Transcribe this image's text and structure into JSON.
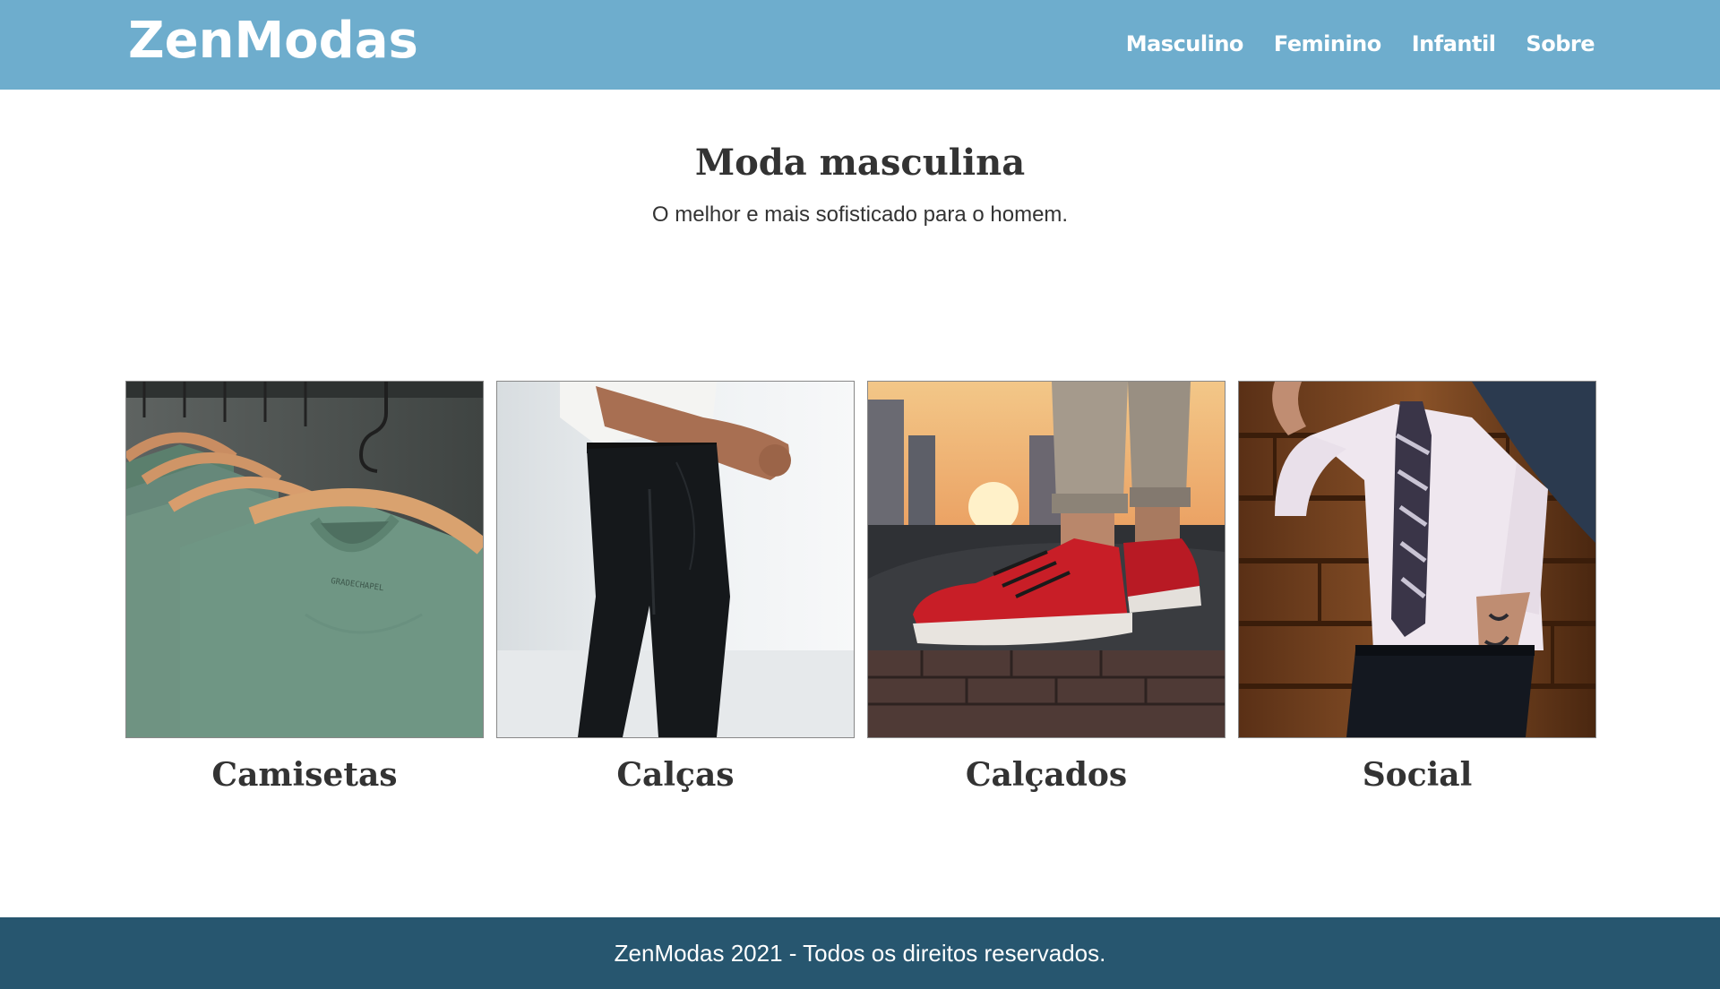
{
  "header": {
    "logo": "ZenModas",
    "nav": [
      {
        "label": "Masculino"
      },
      {
        "label": "Feminino"
      },
      {
        "label": "Infantil"
      },
      {
        "label": "Sobre"
      }
    ]
  },
  "hero": {
    "title": "Moda masculina",
    "subtitle": "O melhor e mais sofisticado para o homem."
  },
  "categories": [
    {
      "label": "Camisetas",
      "image": "green-tshirts-on-hangers"
    },
    {
      "label": "Calças",
      "image": "black-trousers"
    },
    {
      "label": "Calçados",
      "image": "red-sneakers"
    },
    {
      "label": "Social",
      "image": "shirt-and-tie"
    }
  ],
  "footer": {
    "text": "ZenModas 2021 - Todos os direitos reservados."
  },
  "colors": {
    "header_bg": "#6eadcd",
    "footer_bg": "#27566f",
    "text": "#333333"
  }
}
